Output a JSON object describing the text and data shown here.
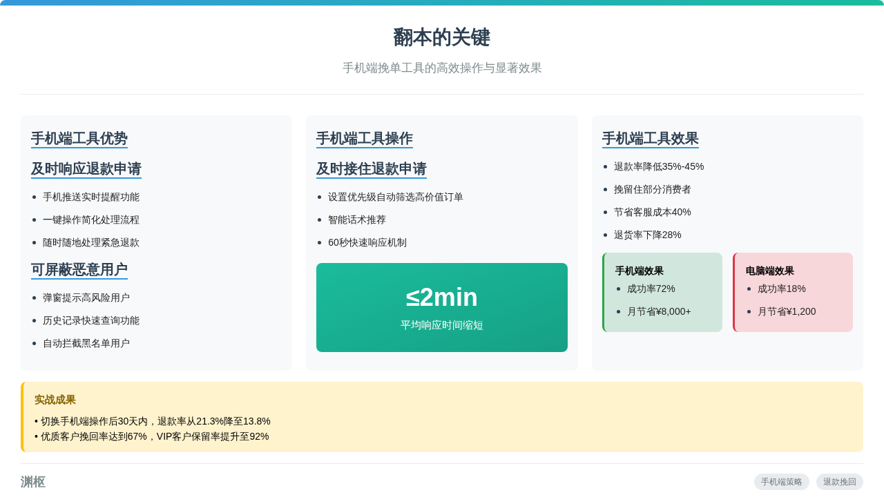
{
  "header": {
    "title": "翻本的关键",
    "subtitle": "手机端挽单工具的高效操作与显著效果"
  },
  "columns": [
    {
      "title": "手机端工具优势",
      "sections": [
        {
          "heading": "及时响应退款申请",
          "items": [
            "手机推送实时提醒功能",
            "一键操作简化处理流程",
            "随时随地处理紧急退款"
          ]
        },
        {
          "heading": "可屏蔽恶意用户",
          "items": [
            "弹窗提示高风险用户",
            "历史记录快速查询功能",
            "自动拦截黑名单用户"
          ]
        }
      ]
    },
    {
      "title": "手机端工具操作",
      "sections": [
        {
          "heading": "及时接住退款申请",
          "items": [
            "设置优先级自动筛选高价值订单",
            "智能话术推荐",
            "60秒快速响应机制"
          ]
        }
      ],
      "highlight": {
        "value": "≤2min",
        "caption": "平均响应时间缩短"
      }
    },
    {
      "title": "手机端工具效果",
      "items": [
        "退款率降低35%-45%",
        "挽留住部分消费者",
        "节省客服成本40%",
        "退货率下降28%"
      ],
      "comparisons": [
        {
          "title": "手机端效果",
          "color": "#28a745",
          "items": [
            "成功率72%",
            "月节省¥8,000+"
          ]
        },
        {
          "title": "电脑端效果",
          "color": "#dc3545",
          "items": [
            "成功率18%",
            "月节省¥1,200"
          ]
        }
      ]
    }
  ],
  "results": {
    "title": "实战成果",
    "lines": [
      "• 切换手机端操作后30天内，退款率从21.3%降至13.8%",
      "• 优质客户挽回率达到67%，VIP客户保留率提升至92%"
    ]
  },
  "footer": {
    "brand": "渊枢",
    "tags": [
      "手机端策略",
      "退款挽回"
    ]
  }
}
